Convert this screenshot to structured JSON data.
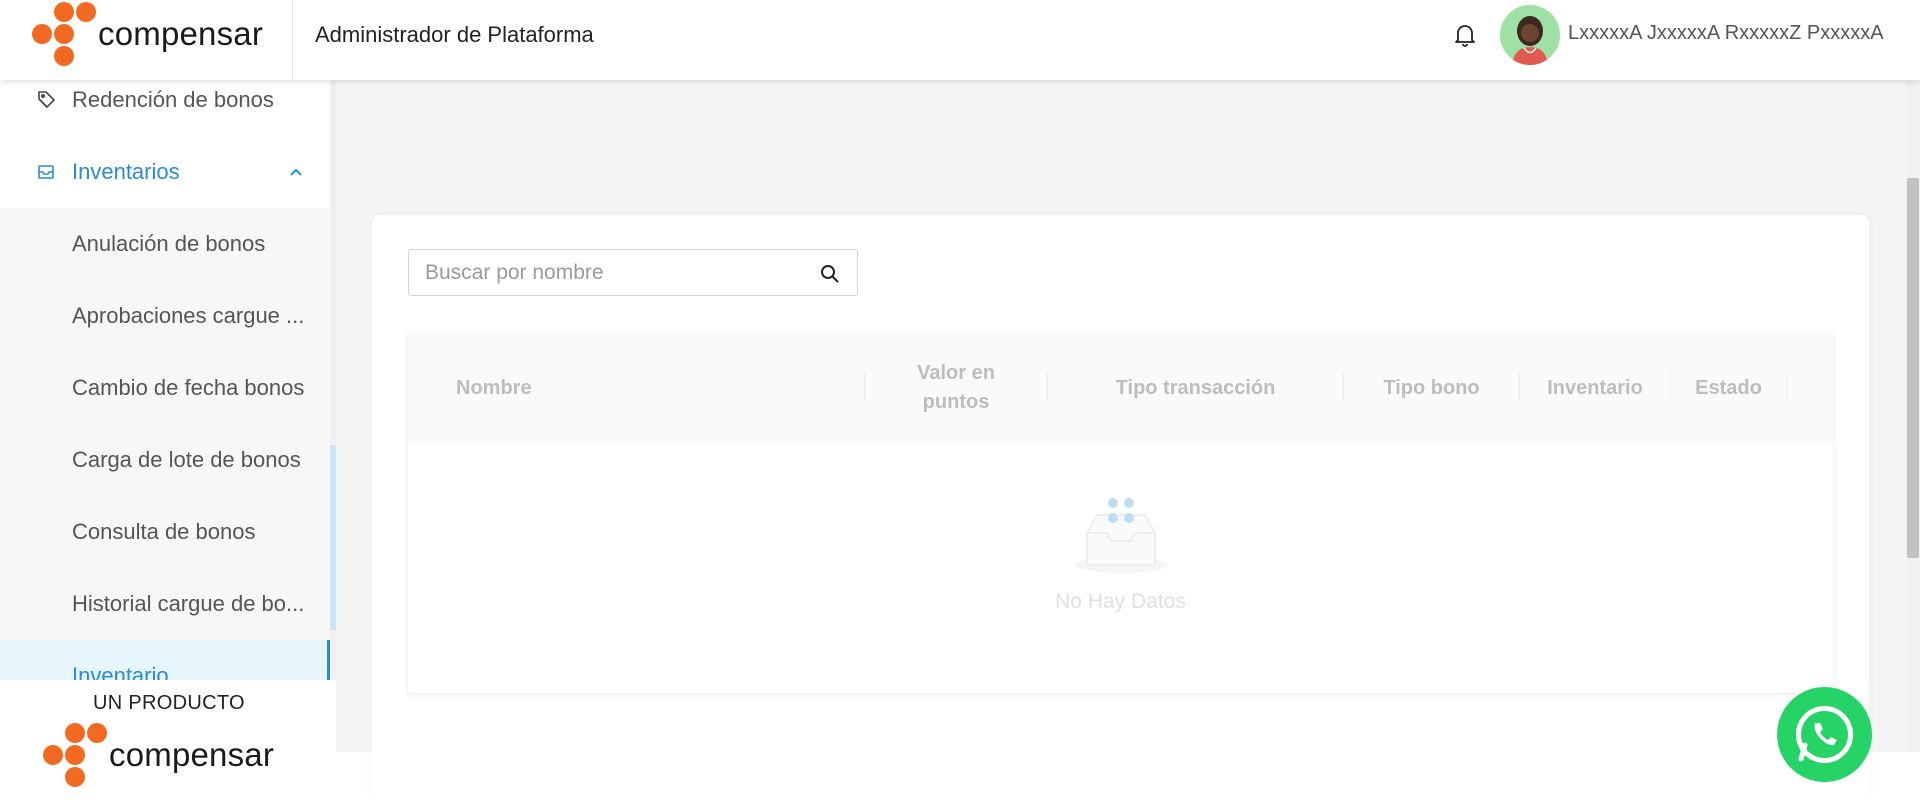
{
  "header": {
    "logo_text": "compensar",
    "title": "Administrador de Plataforma",
    "user_name": "LxxxxxA JxxxxxA RxxxxxZ PxxxxxA",
    "icons": [
      "bell-icon",
      "avatar"
    ]
  },
  "sidebar": {
    "items": [
      {
        "label": "Redención de bonos",
        "icon": "tag-icon"
      },
      {
        "label": "Inventarios",
        "icon": "inbox-icon"
      },
      {
        "label": "Anulación de bonos"
      },
      {
        "label": "Aprobaciones cargue ..."
      },
      {
        "label": "Cambio de fecha bonos"
      },
      {
        "label": "Carga de lote de bonos"
      },
      {
        "label": "Consulta de bonos"
      },
      {
        "label": "Historial cargue de bo..."
      },
      {
        "label": "Inventario"
      }
    ],
    "footer_label": "UN PRODUCTO",
    "footer_logo_text": "compensar"
  },
  "search": {
    "placeholder": "Buscar por nombre"
  },
  "table": {
    "columns": [
      "Nombre",
      "Valor en\npuntos",
      "Tipo transacción",
      "Tipo bono",
      "Inventario",
      "Estado"
    ],
    "empty_text": "No Hay Datos"
  },
  "colors": {
    "brand_orange": "#f26a21",
    "accent_blue": "#2a8bd4",
    "whatsapp_green": "#25d366"
  }
}
